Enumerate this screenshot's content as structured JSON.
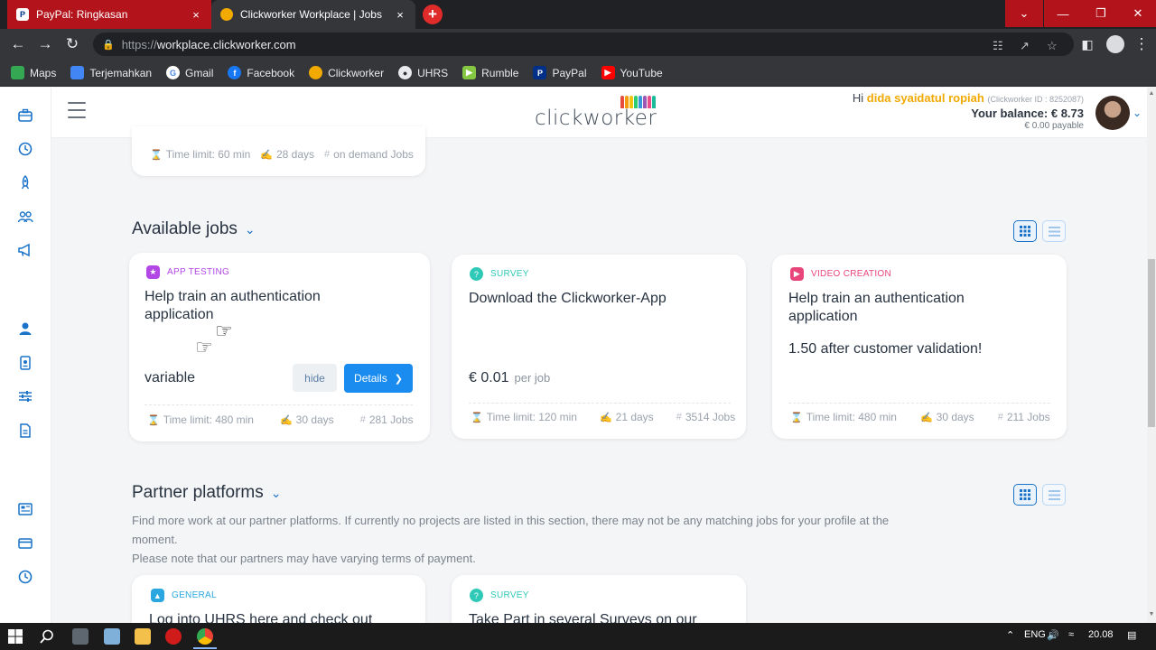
{
  "browser": {
    "tabs": [
      {
        "title": "PayPal: Ringkasan",
        "close": "×"
      },
      {
        "title": "Clickworker Workplace | Jobs",
        "close": "×"
      }
    ],
    "new_tab": "+",
    "window_controls": {
      "dropdown": "⌄",
      "minimize": "—",
      "maximize": "❐",
      "close": "✕"
    },
    "url": {
      "scheme": "https://",
      "host": "workplace.clickworker.com"
    },
    "bookmarks": [
      {
        "label": "Maps",
        "color": "#34a853"
      },
      {
        "label": "Terjemahkan",
        "color": "#4285f4"
      },
      {
        "label": "Gmail",
        "color": "#ea4335"
      },
      {
        "label": "Facebook",
        "color": "#1877f2"
      },
      {
        "label": "Clickworker",
        "color": "#f2a900"
      },
      {
        "label": "UHRS",
        "color": "#3c3c3c"
      },
      {
        "label": "Rumble",
        "color": "#85c742"
      },
      {
        "label": "PayPal",
        "color": "#003087"
      },
      {
        "label": "YouTube",
        "color": "#ff0000"
      }
    ]
  },
  "header": {
    "greeting": "Hi ",
    "user_name": "dida syaidatul ropiah",
    "clickworker_id": "(Clickworker ID : 8252087)",
    "balance": "Your balance: € 8.73",
    "payable": "€ 0.00 payable",
    "logo_text": "clickworker"
  },
  "previous_card": {
    "time_limit": "Time limit: 60 min",
    "days": "28 days",
    "jobs": "on demand Jobs"
  },
  "available_jobs": {
    "title": "Available jobs",
    "cards": [
      {
        "category": "APP TESTING",
        "category_color": "#b347e6",
        "title": "Help train an authentication application",
        "price": "variable",
        "hide_label": "hide",
        "details_label": "Details",
        "time_limit": "Time limit: 480 min",
        "days": "30 days",
        "jobs": "281 Jobs"
      },
      {
        "category": "SURVEY",
        "category_color": "#2fc9b8",
        "title": "Download the Clickworker-App",
        "price": "€ 0.01",
        "price_unit": "per job",
        "time_limit": "Time limit: 120 min",
        "days": "21 days",
        "jobs": "3514 Jobs"
      },
      {
        "category": "VIDEO CREATION",
        "category_color": "#e8457a",
        "title": "Help train an authentication application",
        "note": "1.50 after customer validation!",
        "time_limit": "Time limit: 480 min",
        "days": "30 days",
        "jobs": "211 Jobs"
      }
    ]
  },
  "partner_platforms": {
    "title": "Partner platforms",
    "desc_line1": "Find more work at our partner platforms. If currently no projects are listed in this section, there may not be any matching jobs for your profile at the",
    "desc_line2": "moment.",
    "desc_line3": "Please note that our partners may have varying terms of payment.",
    "cards": [
      {
        "category": "GENERAL",
        "category_color": "#2aa7e0",
        "title": "Log into UHRS here and check out"
      },
      {
        "category": "SURVEY",
        "category_color": "#2fc9b8",
        "title": "Take Part in several Surveys on our"
      }
    ]
  },
  "taskbar": {
    "time": "20.08",
    "lang": "ENG"
  }
}
